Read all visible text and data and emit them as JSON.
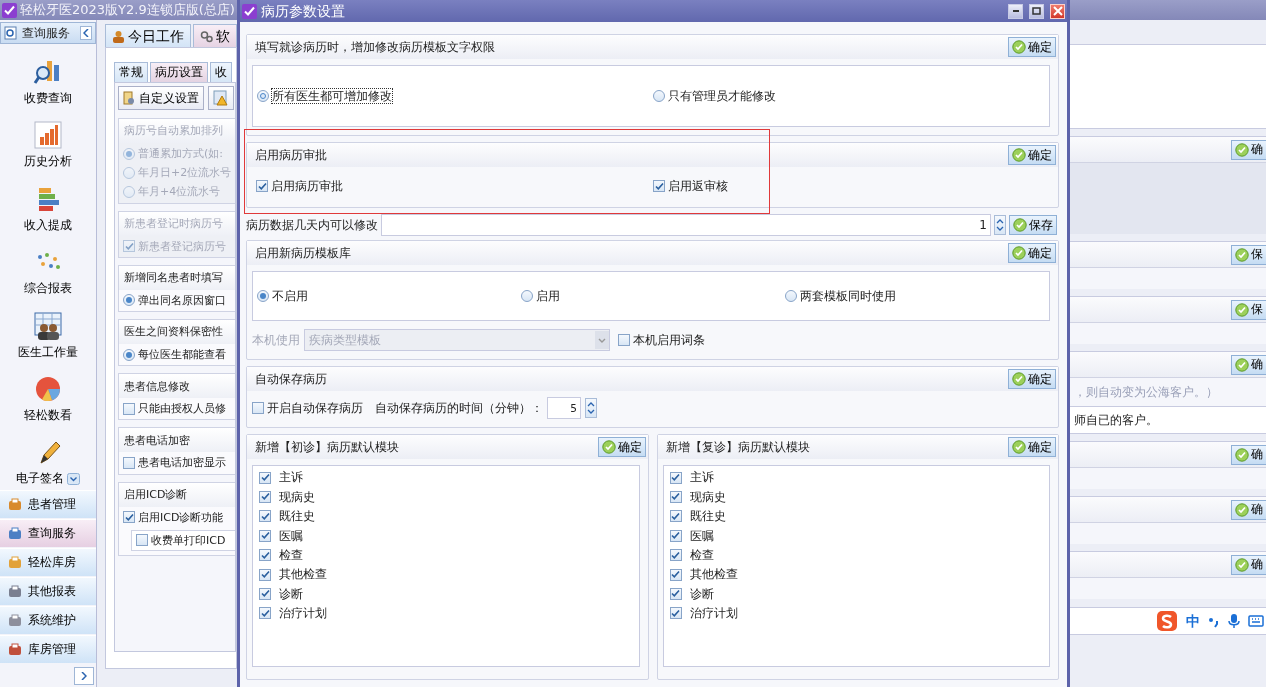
{
  "app": {
    "title": "轻松牙医2023版Y2.9连锁店版(总店)"
  },
  "sidebar": {
    "header": "查询服务",
    "items": [
      {
        "label": "收费查询"
      },
      {
        "label": "历史分析"
      },
      {
        "label": "收入提成"
      },
      {
        "label": "综合报表"
      },
      {
        "label": "医生工作量"
      },
      {
        "label": "轻松数看"
      },
      {
        "label": "电子签名"
      }
    ],
    "sections": [
      {
        "label": "患者管理",
        "selected": false
      },
      {
        "label": "查询服务",
        "selected": true
      },
      {
        "label": "轻松库房",
        "selected": false
      },
      {
        "label": "其他报表",
        "selected": false
      },
      {
        "label": "系统维护",
        "selected": false
      },
      {
        "label": "库房管理",
        "selected": false
      }
    ]
  },
  "main_tabs": [
    {
      "label": "今日工作",
      "selected": true
    },
    {
      "label": "软",
      "selected": false
    }
  ],
  "sub_tabs": [
    {
      "label": "常规",
      "selected": false
    },
    {
      "label": "病历设置",
      "selected": true
    },
    {
      "label": "收",
      "selected": false
    }
  ],
  "toolbar": {
    "buttons": [
      {
        "label": "自定义设置"
      }
    ]
  },
  "settings_groups": [
    {
      "title": "病历号自动累加排列",
      "disabled": true,
      "options": [
        {
          "kind": "radio",
          "label": "普通累加方式(如:",
          "checked": true
        },
        {
          "kind": "radio",
          "label": "年月日+2位流水号",
          "checked": false
        },
        {
          "kind": "radio",
          "label": "年月+4位流水号",
          "checked": false
        }
      ]
    },
    {
      "title": "新患者登记时病历号",
      "disabled": true,
      "options": [
        {
          "kind": "checkbox",
          "label": "新患者登记病历号",
          "checked": true
        }
      ]
    },
    {
      "title": "新增同名患者时填写",
      "disabled": false,
      "options": [
        {
          "kind": "radio",
          "label": "弹出同名原因窗口",
          "checked": true
        }
      ]
    },
    {
      "title": "医生之间资料保密性",
      "disabled": false,
      "options": [
        {
          "kind": "radio",
          "label": "每位医生都能查看",
          "checked": true
        }
      ]
    },
    {
      "title": "患者信息修改",
      "disabled": false,
      "options": [
        {
          "kind": "checkbox",
          "label": "只能由授权人员修",
          "checked": false
        }
      ]
    },
    {
      "title": "患者电话加密",
      "disabled": false,
      "options": [
        {
          "kind": "checkbox",
          "label": "患者电话加密显示",
          "checked": false
        }
      ]
    },
    {
      "title": "启用ICD诊断",
      "disabled": false,
      "options": [
        {
          "kind": "checkbox",
          "label": "启用ICD诊断功能",
          "checked": true
        },
        {
          "kind": "sub_checkbox",
          "label": "收费单打印ICD",
          "checked": false
        }
      ]
    }
  ],
  "right_panels": [
    {
      "button": "确"
    },
    {
      "button": "保"
    },
    {
      "button": "保"
    },
    {
      "button": "确",
      "lines": [
        {
          "text": "，则自动变为公海客户。）",
          "disabled": true
        },
        {
          "text": "师自已的客户。",
          "disabled": false
        }
      ]
    },
    {
      "button": "确"
    },
    {
      "button": "确"
    },
    {
      "button": "确"
    }
  ],
  "ime": {
    "mode": "中"
  },
  "dialog": {
    "title": "病历参数设置",
    "sections": [
      {
        "kind": "radio_box",
        "title": "填写就诊病历时，增加修改病历模板文字权限",
        "button": "确定",
        "options": [
          {
            "label": "所有医生都可增加修改",
            "selected": true,
            "focused": true
          },
          {
            "label": "只有管理员才能修改",
            "selected": false,
            "focused": false
          }
        ]
      },
      {
        "kind": "checks",
        "title": "启用病历审批",
        "button": "确定",
        "highlighted": true,
        "options": [
          {
            "label": "启用病历审批",
            "checked": true
          },
          {
            "label": "启用返审核",
            "checked": true
          }
        ]
      },
      {
        "kind": "field_row",
        "label": "病历数据几天内可以修改",
        "value": "1",
        "button": "保存"
      },
      {
        "kind": "radio_box",
        "title": "启用新病历模板库",
        "button": "确定",
        "options": [
          {
            "label": "不启用",
            "selected": true,
            "focused": false
          },
          {
            "label": "启用",
            "selected": false,
            "focused": false
          },
          {
            "label": "两套模板同时使用",
            "selected": false,
            "focused": false
          }
        ],
        "local": {
          "label": "本机使用",
          "select": "疾病类型模板",
          "disabled": true,
          "checkbox": {
            "label": "本机启用词条",
            "checked": false
          }
        }
      },
      {
        "kind": "autosave",
        "title": "自动保存病历",
        "button": "确定",
        "checkbox": {
          "label": "开启自动保存病历",
          "checked": false
        },
        "label": "自动保存病历的时间（分钟）：",
        "value": "5"
      },
      {
        "kind": "module_pair",
        "panels": [
          {
            "title": "新增【初诊】病历默认模块",
            "button": "确定",
            "modules": [
              {
                "label": "主诉",
                "checked": true
              },
              {
                "label": "现病史",
                "checked": true
              },
              {
                "label": "既往史",
                "checked": true
              },
              {
                "label": "医嘱",
                "checked": true
              },
              {
                "label": "检查",
                "checked": true
              },
              {
                "label": "其他检查",
                "checked": true
              },
              {
                "label": "诊断",
                "checked": true
              },
              {
                "label": "治疗计划",
                "checked": true
              }
            ]
          },
          {
            "title": "新增【复诊】病历默认模块",
            "button": "确定",
            "modules": [
              {
                "label": "主诉",
                "checked": true
              },
              {
                "label": "现病史",
                "checked": true
              },
              {
                "label": "既往史",
                "checked": true
              },
              {
                "label": "医嘱",
                "checked": true
              },
              {
                "label": "检查",
                "checked": true
              },
              {
                "label": "其他检查",
                "checked": true
              },
              {
                "label": "诊断",
                "checked": true
              },
              {
                "label": "治疗计划",
                "checked": true
              }
            ]
          }
        ]
      }
    ]
  }
}
